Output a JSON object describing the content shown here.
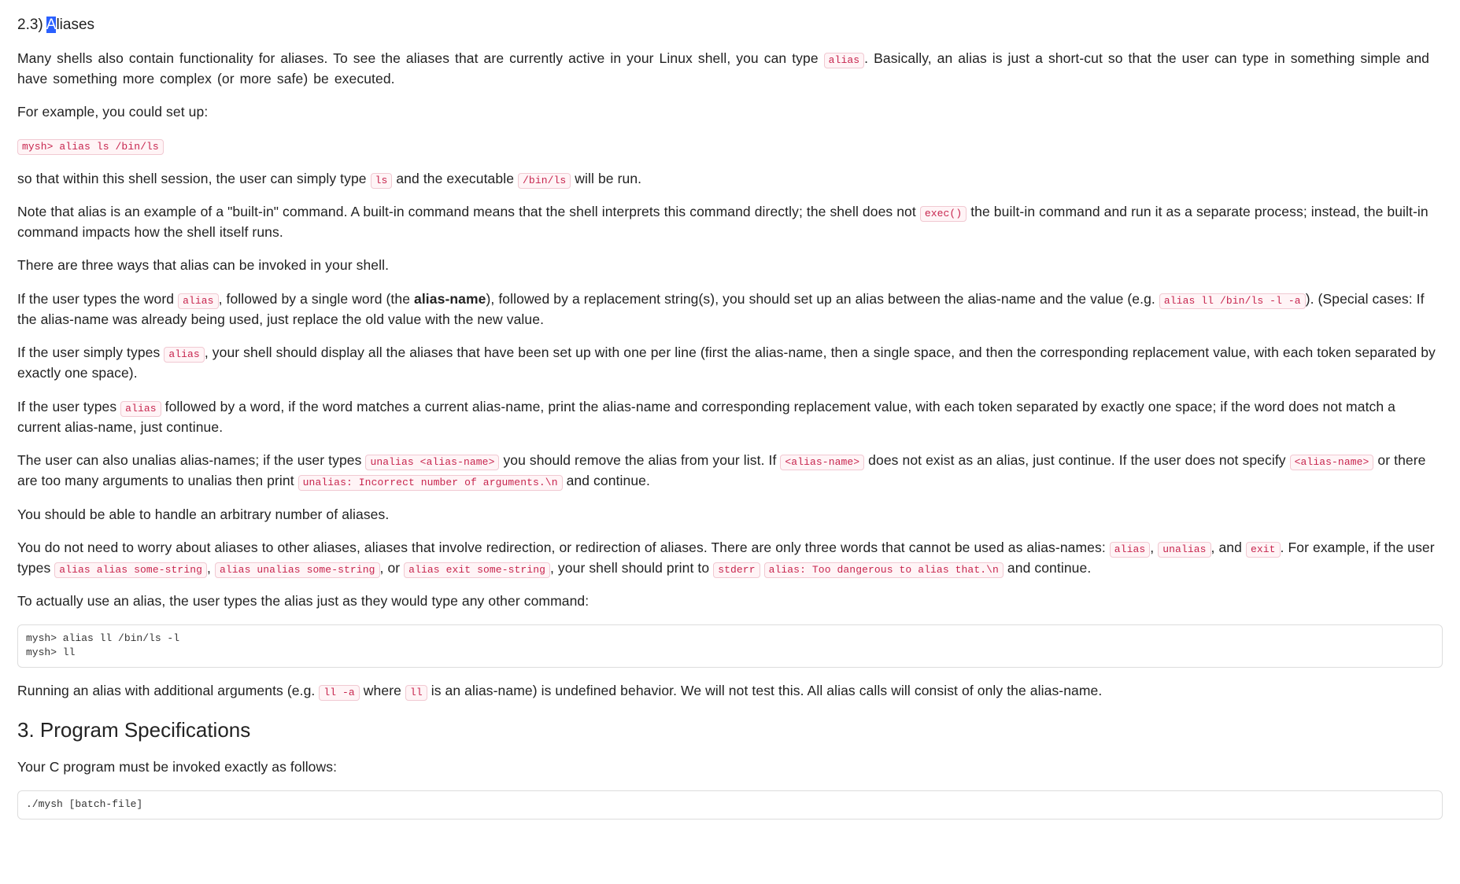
{
  "section_2_3": {
    "number": "2.3)",
    "title_first_char": "A",
    "title_rest": "liases",
    "p1_a": "Many shells also contain functionality for aliases.   To see the aliases that are currently active in your Linux shell, you can type ",
    "code_alias": "alias",
    "p1_b": ".   Basically, an alias is just a short-cut so that the user can type in something simple and have something more complex (or more safe) be executed.",
    "p2": "For example, you could set up:",
    "code_setup": "mysh> alias ls /bin/ls",
    "p3_a": "so that within this shell session, the user can simply type ",
    "code_ls": "ls",
    "p3_b": " and the executable ",
    "code_binls": "/bin/ls",
    "p3_c": " will be run.",
    "p4_a": "Note that alias is an example of a \"built-in\" command. A built-in command means that the shell interprets this command directly; the shell does not ",
    "code_exec": "exec()",
    "p4_b": " the built-in command and run it as a separate process; instead, the built-in command impacts how the shell itself runs.",
    "p5": "There are three ways that alias can be invoked in your shell.",
    "p6_a": "If the user types the word ",
    "p6_b": ", followed by a single word (the ",
    "p6_strong": "alias-name",
    "p6_c": "), followed by a replacement string(s), you should set up an alias between the alias-name and the value (e.g. ",
    "code_alias_ll": "alias ll /bin/ls -l -a",
    "p6_d": "). (Special cases: If the alias-name was already being used, just replace the old value with the new value.",
    "p7_a": "If the user simply types ",
    "p7_b": ", your shell should display all the aliases that have been set up with one per line (first the alias-name, then a single space, and then the corresponding replacement value, with each token separated by exactly one space).",
    "p8_a": "If the user types ",
    "p8_b": " followed by a word, if the word matches a current alias-name, print the alias-name and corresponding replacement value, with each token separated by exactly one space; if the word does not match a current alias-name, just continue.",
    "p9_a": "The user can also unalias alias-names; if the user types ",
    "code_unalias_an": "unalias <alias-name>",
    "p9_b": " you should remove the alias from your list. If ",
    "code_an": "<alias-name>",
    "p9_c": " does not exist as an alias, just continue. If the user does not specify ",
    "p9_d": " or there are too many arguments to unalias then print ",
    "code_unalias_err": "unalias: Incorrect number of arguments.\\n",
    "p9_e": " and continue.",
    "p10": "You should be able to handle an arbitrary number of aliases.",
    "p11_a": "You do not need to worry about aliases to other aliases, aliases that involve redirection, or redirection of aliases. There are only three words that cannot be used as alias-names: ",
    "code_alias_w": "alias",
    "p11_b": ", ",
    "code_unalias_w": "unalias",
    "p11_c": ", and ",
    "code_exit_w": "exit",
    "p11_d": ". For example, if the user types ",
    "code_aas": "alias alias some-string",
    "p11_e": ", ",
    "code_aus": "alias unalias some-string",
    "p11_f": ", or ",
    "code_aes": "alias exit some-string",
    "p11_g": ", your shell should print to ",
    "code_stderr": "stderr",
    "space": " ",
    "code_danger": "alias: Too dangerous to alias that.\\n",
    "p11_h": " and continue.",
    "p12": "To actually use an alias, the user types the alias just as they would type any other command:",
    "code_example_block": "mysh> alias ll /bin/ls -l\nmysh> ll",
    "p13_a": "Running an alias with additional arguments (e.g. ",
    "code_lla": "ll -a",
    "p13_b": " where ",
    "code_ll": "ll",
    "p13_c": " is an alias-name) is undefined behavior. We will not test this. All alias calls will consist of only the alias-name."
  },
  "section_3": {
    "title": "3. Program Specifications",
    "p1": "Your C program must be invoked exactly as follows:",
    "code_invoke": "./mysh [batch-file]"
  }
}
